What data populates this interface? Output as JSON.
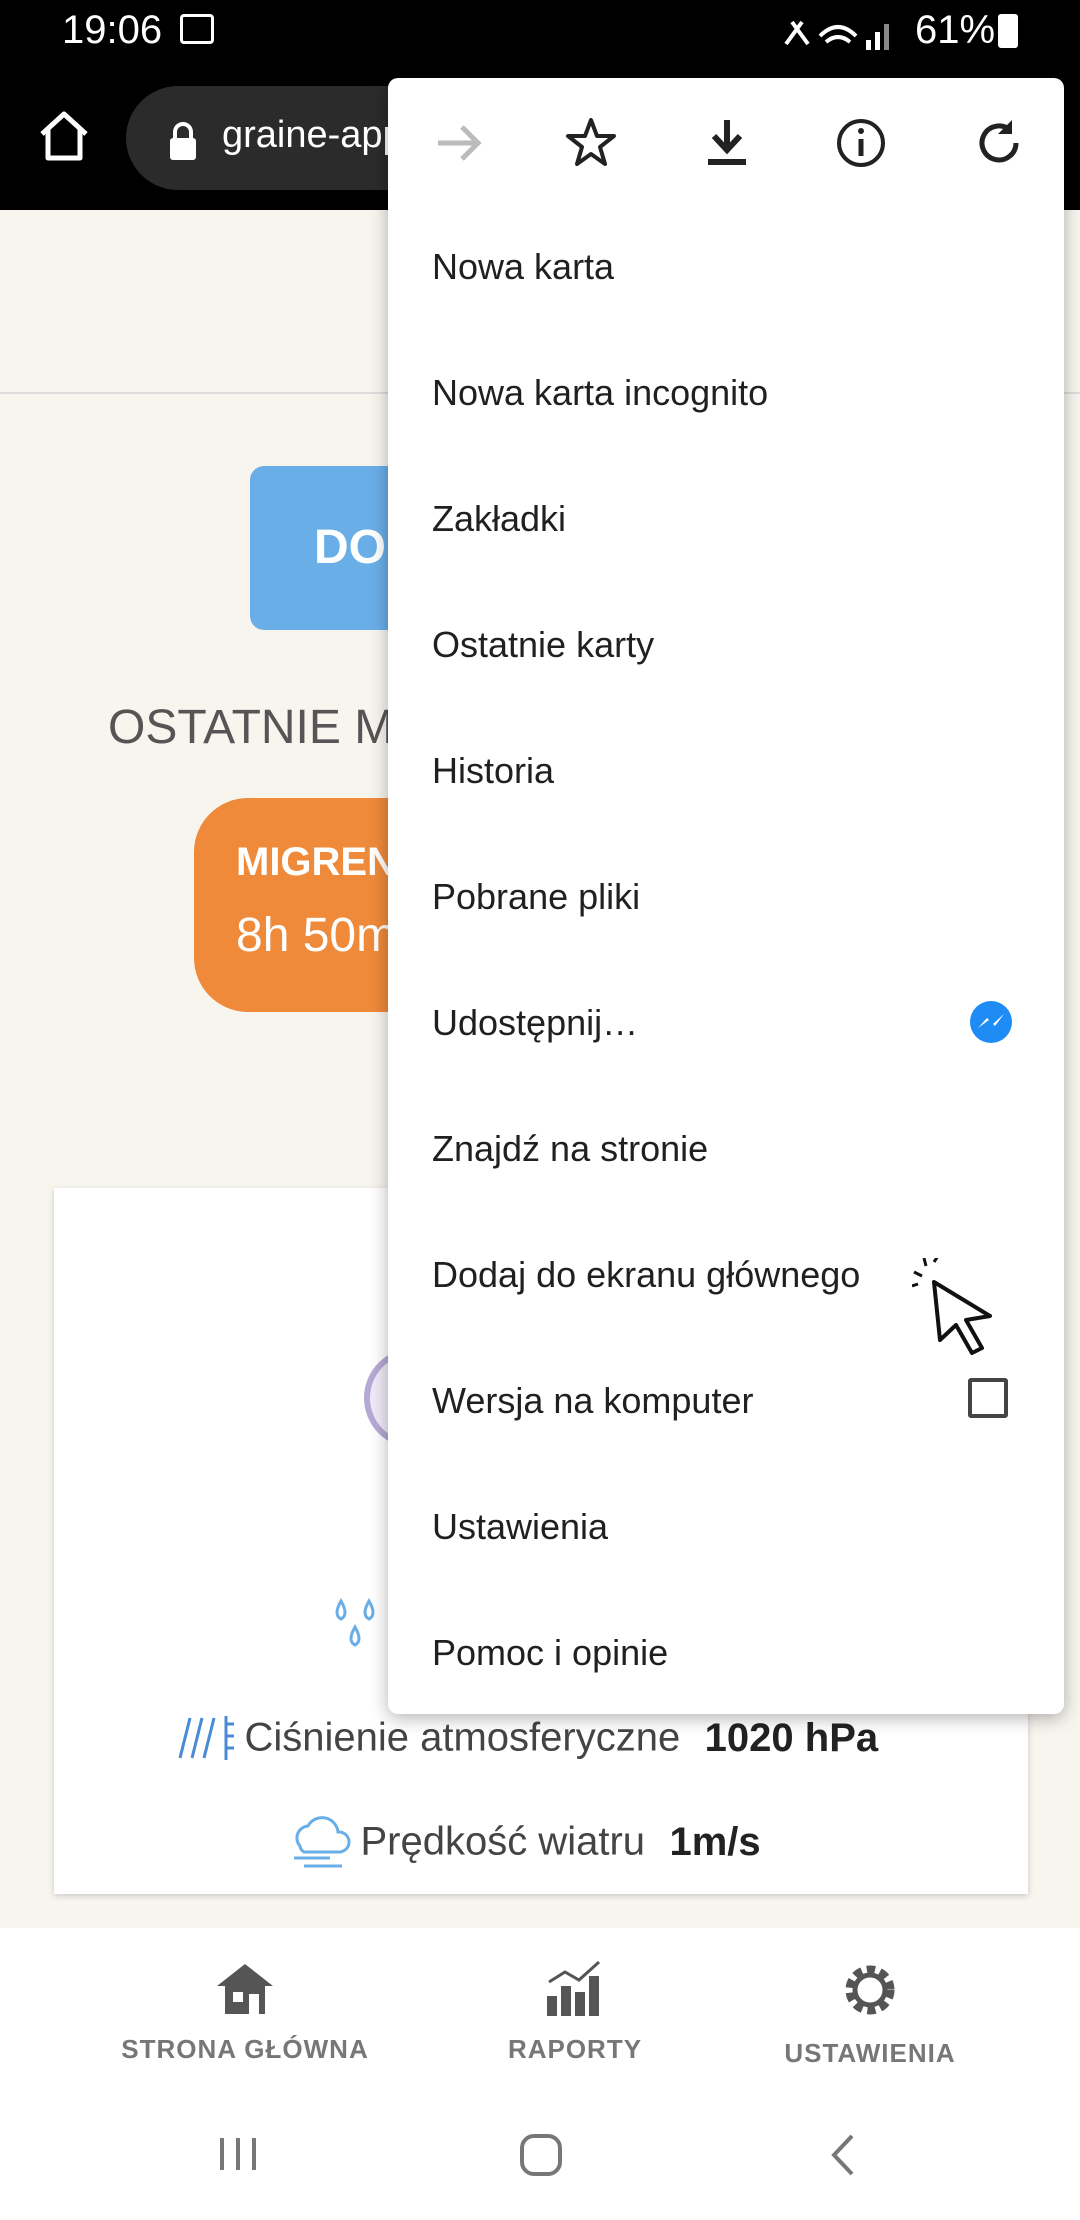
{
  "status_bar": {
    "time": "19:06",
    "battery": "61%"
  },
  "browser": {
    "url": "graine-app"
  },
  "page": {
    "add_button_label": "DO",
    "recent_title": "OSTATNIE M",
    "migraine": {
      "label": "MIGREN",
      "duration": "8h 50m"
    },
    "weather": {
      "pressure_label": "Ciśnienie atmosferyczne",
      "pressure_value": "1020 hPa",
      "wind_label": "Prędkość wiatru",
      "wind_value": "1m/s"
    }
  },
  "bottom_nav": [
    {
      "label": "STRONA GŁÓWNA",
      "icon": "house-icon"
    },
    {
      "label": "RAPORTY",
      "icon": "bar-chart-icon"
    },
    {
      "label": "USTAWIENIA",
      "icon": "gear-icon"
    }
  ],
  "menu": {
    "toolbar_icons": [
      "forward-icon",
      "star-icon",
      "download-icon",
      "info-icon",
      "reload-icon"
    ],
    "items": [
      "Nowa karta",
      "Nowa karta incognito",
      "Zakładki",
      "Ostatnie karty",
      "Historia",
      "Pobrane pliki",
      "Udostępnij…",
      "Znajdź na stronie",
      "Dodaj do ekranu głównego",
      "Wersja na komputer",
      "Ustawienia",
      "Pomoc i opinie"
    ],
    "desktop_version_checked": false
  },
  "colors": {
    "add_button": "#6aaee8",
    "migraine_card": "#ef8a3a",
    "page_background": "#f8f5ef"
  }
}
